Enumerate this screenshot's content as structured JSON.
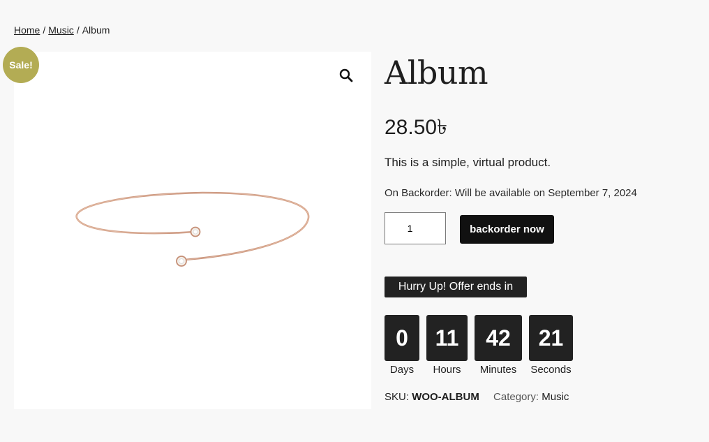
{
  "breadcrumb": {
    "items": [
      {
        "label": "Home"
      },
      {
        "label": "Music"
      }
    ],
    "separator": "/",
    "current": "Album"
  },
  "gallery": {
    "sale_badge": "Sale!",
    "zoom_icon": "search-icon",
    "image": "rose-gold-bangle-bracelet"
  },
  "product": {
    "title": "Album",
    "price": "28.50৳",
    "description": "This is a simple, virtual product.",
    "stock_status": "On Backorder: Will be available on September 7, 2024",
    "quantity": "1",
    "button_label": "backorder now"
  },
  "countdown": {
    "banner": "Hurry Up! Offer ends in",
    "units": [
      {
        "value": "0",
        "label": "Days"
      },
      {
        "value": "11",
        "label": "Hours"
      },
      {
        "value": "42",
        "label": "Minutes"
      },
      {
        "value": "21",
        "label": "Seconds"
      }
    ]
  },
  "meta": {
    "sku_label": "SKU:",
    "sku_value": "WOO-ALBUM",
    "category_label": "Category:",
    "category_value": "Music"
  },
  "colors": {
    "sale_badge": "#b3ac54",
    "dark": "#222222",
    "background": "#f8f8f8"
  }
}
